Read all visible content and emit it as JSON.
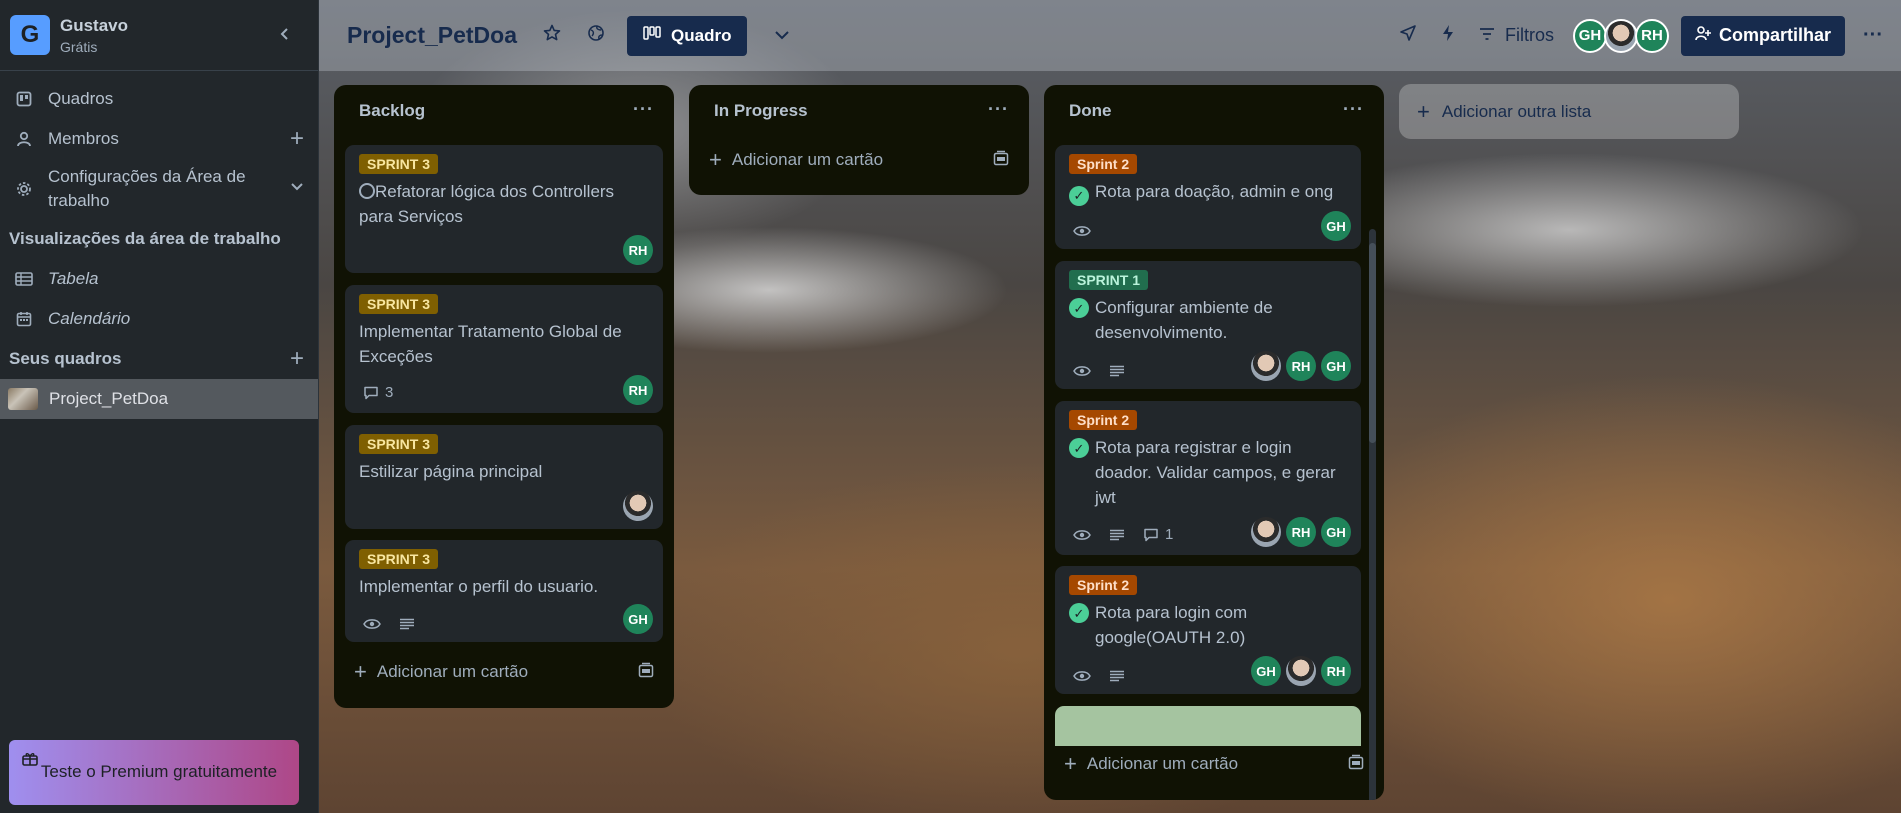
{
  "workspace": {
    "initial": "G",
    "name": "Gustavo",
    "plan": "Grátis",
    "collapse_icon": "chevron-left-icon"
  },
  "sidebar": {
    "items": [
      {
        "label": "Quadros",
        "icon": "board-icon"
      },
      {
        "label": "Membros",
        "icon": "person-icon"
      },
      {
        "label": "Configurações da Área de trabalho",
        "icon": "gear-icon"
      }
    ],
    "views_title": "Visualizações da área de trabalho",
    "views": [
      {
        "label": "Tabela",
        "icon": "table-icon"
      },
      {
        "label": "Calendário",
        "icon": "calendar-icon"
      }
    ],
    "boards_title": "Seus quadros",
    "boards": [
      {
        "label": "Project_PetDoa"
      }
    ],
    "premium": "Teste o Premium gratuitamente"
  },
  "header": {
    "title": "Project_PetDoa",
    "view_label": "Quadro",
    "filters_label": "Filtros",
    "share_label": "Compartilhar",
    "members": [
      "GH",
      "",
      "RH"
    ]
  },
  "lists": [
    {
      "title": "Backlog",
      "add_card": "Adicionar um cartão",
      "cards": [
        {
          "label": "SPRINT 3",
          "title": "Refatorar lógica dos Controllers para Serviços",
          "members": [
            "RH"
          ]
        },
        {
          "label": "SPRINT 3",
          "title": "Implementar Tratamento Global de Exceções",
          "comments": "3",
          "members": [
            "RH"
          ]
        },
        {
          "label": "SPRINT 3",
          "title": "Estilizar página principal",
          "members": [
            ""
          ]
        },
        {
          "label": "SPRINT 3",
          "title": "Implementar o perfil do usuario.",
          "members": [
            "GH"
          ]
        }
      ]
    },
    {
      "title": "In Progress",
      "add_card": "Adicionar um cartão",
      "cards": []
    },
    {
      "title": "Done",
      "add_card": "Adicionar um cartão",
      "cards": [
        {
          "label": "Sprint 2",
          "title": "Rota para doação, admin e ong",
          "members": [
            "GH"
          ]
        },
        {
          "label": "SPRINT 1",
          "title": "Configurar ambiente de desenvolvimento.",
          "members": [
            "",
            "RH",
            "GH"
          ]
        },
        {
          "label": "Sprint 2",
          "title": "Rota para registrar e login doador. Validar campos, e gerar jwt",
          "comments": "1",
          "members": [
            "",
            "RH",
            "GH"
          ]
        },
        {
          "label": "Sprint 2",
          "title": "Rota para login com google(OAUTH 2.0)",
          "members": [
            "GH",
            "",
            "RH"
          ]
        }
      ]
    }
  ],
  "add_list": "Adicionar outra lista",
  "colors": {
    "label_yellow": "#7f5f01",
    "label_orange": "#a54800",
    "label_green": "#216e4e",
    "member_green": "#1f845a",
    "brand_dark": "#172b4d"
  }
}
